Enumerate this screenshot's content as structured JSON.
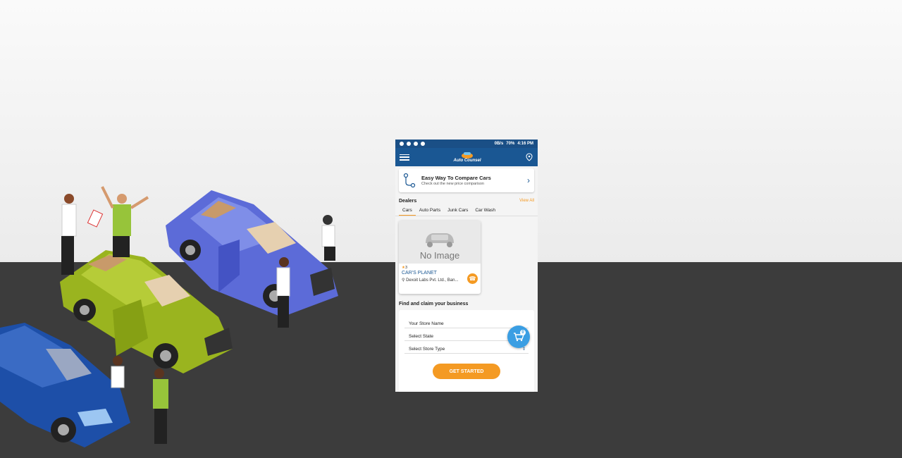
{
  "status_bar": {
    "speed": "0B/s",
    "battery": "70%",
    "time": "4:16 PM"
  },
  "app": {
    "logo_text": "Auto Counsel",
    "menu_icon": "hamburger-menu-icon",
    "location_icon": "location-pin-icon"
  },
  "compare": {
    "title": "Easy Way To Compare Cars",
    "subtitle": "Check out the new price comparison"
  },
  "dealers": {
    "title": "Dealers",
    "view_all": "View All",
    "tabs": [
      "Cars",
      "Auto Parts",
      "Junk Cars",
      "Car Wash"
    ],
    "active_tab": "Cars",
    "card": {
      "placeholder": "No Image",
      "rating": "3",
      "name": "CAR'S PLANET",
      "address": "Dexoit Labs Pvt. Ltd., Ban..."
    }
  },
  "claim": {
    "title": "Find and claim your business",
    "fields": [
      "Your Store Name",
      "Select State",
      "Select Store Type"
    ],
    "cta": "GET STARTED"
  },
  "cart_badge": "0",
  "colors": {
    "primary": "#1a5793",
    "accent": "#f49a23",
    "fab": "#3a9ee3",
    "ground": "#3c3c3c"
  }
}
